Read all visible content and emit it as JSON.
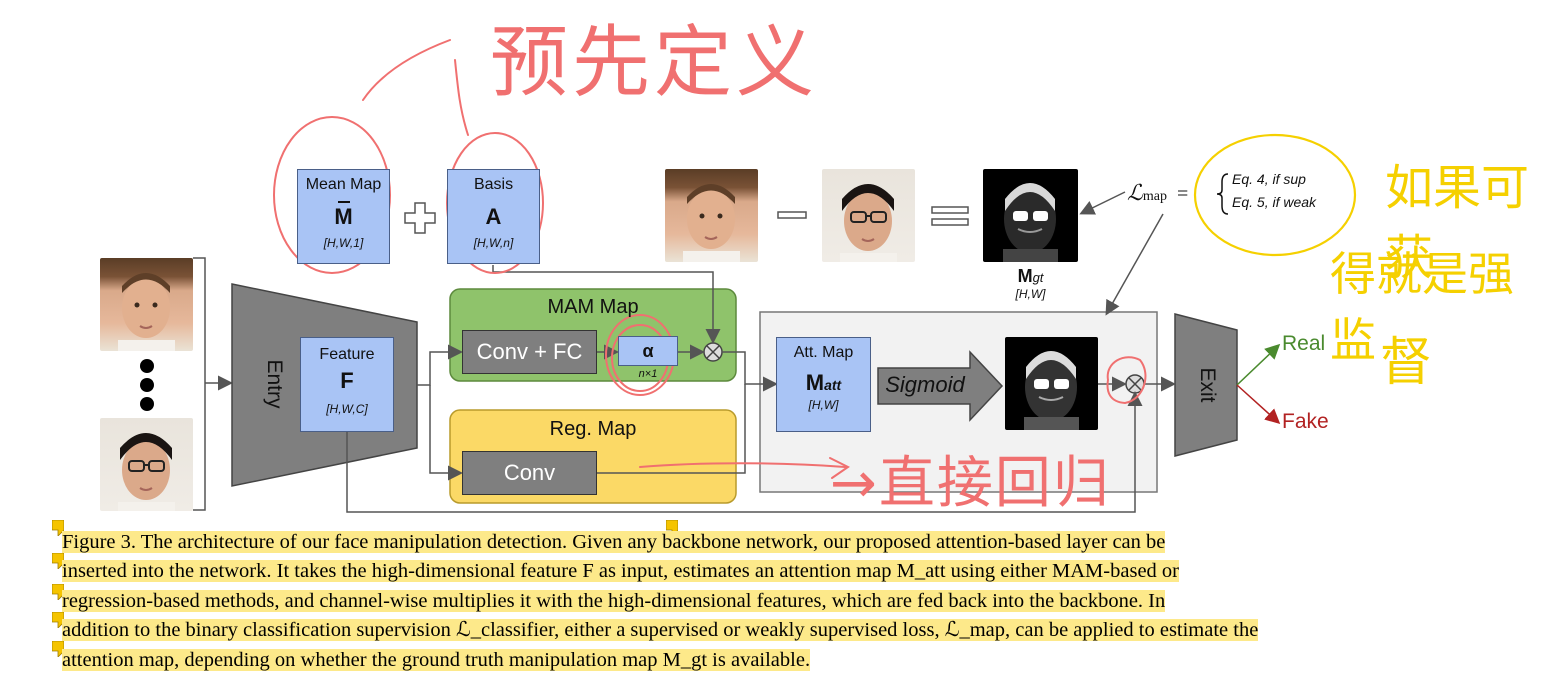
{
  "figure": {
    "mean_map": {
      "title": "Mean Map",
      "symbol": "M",
      "dims": "[H,W,1]"
    },
    "basis": {
      "title": "Basis",
      "symbol": "A",
      "dims": "[H,W,n]"
    },
    "entry_label": "Entry",
    "feature": {
      "title": "Feature",
      "symbol": "F",
      "dims": "[H,W,C]"
    },
    "mam_map": {
      "title": "MAM Map",
      "conv_fc": "Conv + FC",
      "alpha": "α",
      "alpha_dims": "n×1"
    },
    "reg_map": {
      "title": "Reg. Map",
      "conv": "Conv"
    },
    "att_map": {
      "title": "Att. Map",
      "symbol": "M",
      "subscript": "att",
      "dims": "[H,W]"
    },
    "sigmoid": "Sigmoid",
    "exit_label": "Exit",
    "outputs": {
      "real": "Real",
      "fake": "Fake"
    },
    "mgt": {
      "symbol": "M",
      "subscript": "gt",
      "dims": "[H,W]"
    },
    "loss": {
      "symbol": "ℒ",
      "subscript": "map",
      "eq_sup": "Eq. 4, if sup",
      "eq_weak": "Eq. 5, if weak"
    }
  },
  "annotations": {
    "top_handwriting": "预先定义",
    "right_handwriting_line1": "如果可获",
    "right_handwriting_line2": "得就是强监",
    "right_handwriting_line3": "督",
    "bottom_handwriting": "→直接回归"
  },
  "caption": {
    "lines": [
      "Figure 3. The architecture of our face manipulation detection. Given any backbone network, our proposed attention-based layer can be",
      "inserted into the network. It takes the high-dimensional feature F as input, estimates an attention map M_att using either MAM-based or",
      "regression-based methods, and channel-wise multiplies it with the high-dimensional features, which are fed back into the backbone. In",
      "addition to the binary classification supervision ℒ_classifier, either a supervised or weakly supervised loss, ℒ_map, can be applied to estimate the",
      "attention map, depending on whether the ground truth manipulation map M_gt is available."
    ]
  },
  "colors": {
    "blue_box": "#a9c4f5",
    "green_box": "#8fc36b",
    "yellow_box": "#fbd966",
    "gray_box": "#7f7f7f",
    "real": "#4a8a2e",
    "fake": "#b22222",
    "annotation_red": "#f07070",
    "annotation_yellow": "#f5d000",
    "highlight": "#fde98a"
  }
}
